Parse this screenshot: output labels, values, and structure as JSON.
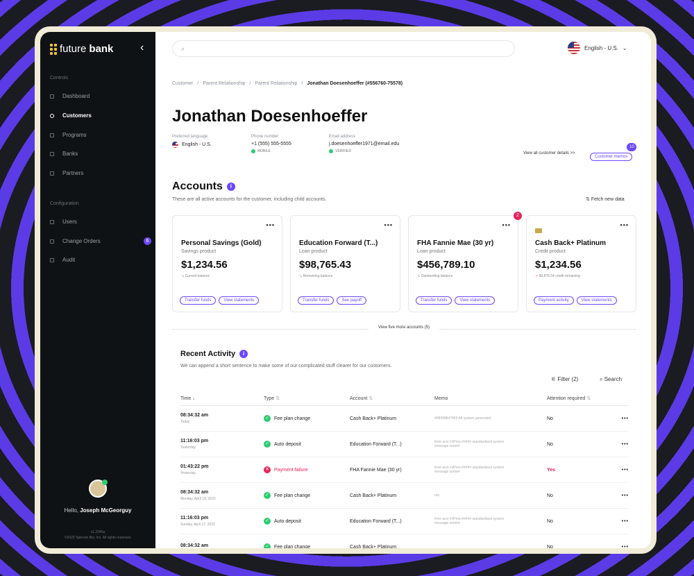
{
  "sidebar": {
    "brand_left": "future",
    "brand_right": "bank",
    "controls_label": "Controls",
    "controls": [
      "Dashboard",
      "Customers",
      "Programs",
      "Banks",
      "Partners"
    ],
    "config_label": "Configuration",
    "config": [
      "Users",
      "Change Orders",
      "Audit"
    ],
    "change_orders_badge": "6",
    "hello_prefix": "Hello,",
    "user_name": "Joseph McGeorguy",
    "version": "v1.2345a",
    "copyright": "©2022 Splendo Biz, Inc. All rights reserved."
  },
  "topbar": {
    "search_placeholder": "",
    "language": "English - U.S."
  },
  "breadcrumb": [
    "Customer",
    "Parent Relationship",
    "Parent Relationship"
  ],
  "breadcrumb_current": "Jonathan Doesenhoeffer (#556760-75578)",
  "customer": {
    "name": "Jonathan Doesenhoeffer",
    "pref_lang_label": "Preferred language",
    "pref_lang": "English - U.S.",
    "phone_label": "Phone number",
    "phone": "+1 (555) 555-5555",
    "phone_tag": "MOBILE",
    "email_label": "Email address",
    "email": "j.doesenhoeffer1971@email.edu",
    "email_tag": "VERIFIED",
    "view_all": "View all customer details >>",
    "memos_label": "Customer memos",
    "memos_count": "10"
  },
  "accounts": {
    "title": "Accounts",
    "subtitle": "These are all active accounts for the customer, including child accounts.",
    "fetch": "Fetch new data",
    "view_more": "View five more accounts (5)",
    "cards": [
      {
        "name": "Personal Savings (Gold)",
        "type": "Savings product",
        "amount": "$1,234.56",
        "balance": "Current balance",
        "actions": [
          "Transfer funds",
          "View statements"
        ]
      },
      {
        "name": "Education Forward (T...)",
        "type": "Loan product",
        "amount": "$98,765.43",
        "balance": "Remaining balance",
        "actions": [
          "Transfer funds",
          "See payoff"
        ]
      },
      {
        "name": "FHA Fannie Mae (30 yr)",
        "type": "Loan product",
        "amount": "$456,789.10",
        "balance": "Outstanding balance",
        "actions": [
          "Transfer funds",
          "View statements"
        ],
        "alert": "2"
      },
      {
        "name": "Cash Back+ Platinum",
        "type": "Credit product",
        "amount": "$1,234.56",
        "balance": "$9,876.54 credit remaining",
        "actions": [
          "Payment activity",
          "View statements"
        ]
      }
    ]
  },
  "activity": {
    "title": "Recent Activity",
    "subtitle": "We can append a short sentence to make some of our complicated stuff clearer for our customers.",
    "filter": "Filter (2)",
    "search": "Search",
    "columns": [
      "Time",
      "Type",
      "Account",
      "Memo",
      "Attention required"
    ],
    "rows": [
      {
        "time": "08:34:32 am",
        "day": "Today",
        "type": "Fee plan change",
        "status": "ok",
        "account": "Cash Back+ Platinum",
        "memo": "#98998847869 Alt system generated",
        "attention": "No"
      },
      {
        "time": "11:16:03 pm",
        "day": "Yesterday",
        "type": "Auto deposit",
        "status": "ok",
        "account": "Education Forward (T...)",
        "memo": "from acct #JPmo-##### standardized system message some#",
        "attention": "No"
      },
      {
        "time": "01:43:22 pm",
        "day": "Yesterday",
        "type": "Payment failure",
        "status": "fail",
        "account": "FHA Fannie Mae (30 yr)",
        "memo": "from acct #JPmo-##### standardized system message some#",
        "attention": "Yes"
      },
      {
        "time": "08:34:32 am",
        "day": "Monday, April 18, 2022",
        "type": "Fee plan change",
        "status": "ok",
        "account": "Cash Back+ Platinum",
        "memo": "n/a",
        "attention": "No"
      },
      {
        "time": "11:16:03 pm",
        "day": "Sunday, April 17, 2022",
        "type": "Auto deposit",
        "status": "ok",
        "account": "Education Forward (T...)",
        "memo": "from acct #JPmo-##### standardized system message some#",
        "attention": "No"
      },
      {
        "time": "08:34:32 am",
        "day": "",
        "type": "Fee plan change",
        "status": "ok",
        "account": "Cash Back+ Platinum",
        "memo": "",
        "attention": "No"
      }
    ]
  },
  "colors": {
    "accent": "#6c47ff",
    "danger": "#e5245b",
    "success": "#2ecc71",
    "sidebar": "#0f1214"
  }
}
